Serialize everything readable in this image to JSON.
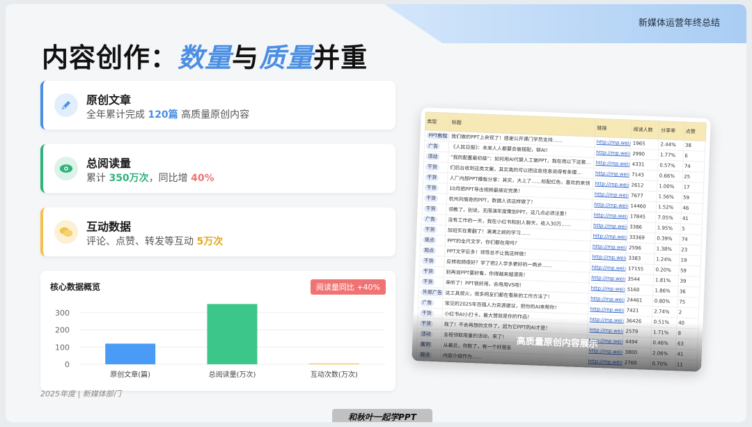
{
  "header": {
    "corner_label": "新媒体运营年终总结"
  },
  "title": {
    "part1": "内容创作：",
    "hl1": "数量",
    "part2": "与",
    "hl2": "质量",
    "part3": "并重"
  },
  "cards": [
    {
      "title": "原创文章",
      "pre": "全年累计完成 ",
      "value": "120篇",
      "post": " 高质量原创内容",
      "color": "#4a8fe3",
      "icon": "pen-icon"
    },
    {
      "title": "总阅读量",
      "pre": "累计 ",
      "value": "350万次",
      "mid": "，同比增 ",
      "value2": "40%",
      "color": "#2fb37a",
      "icon": "eye-icon"
    },
    {
      "title": "互动数据",
      "pre": "评论、点赞、转发等互动 ",
      "value": "5万次",
      "color": "#f2c14e",
      "icon": "chat-icon"
    }
  ],
  "chart_card": {
    "title": "核心数据概览",
    "badge": "阅读量同比 +40%"
  },
  "chart_data": {
    "type": "bar",
    "categories": [
      "原创文章(篇)",
      "总阅读量(万次)",
      "互动次数(万次)"
    ],
    "values": [
      120,
      350,
      5
    ],
    "colors": [
      "#4a9bf5",
      "#3cc68a",
      "#f5c842"
    ],
    "yticks": [
      0,
      100,
      200,
      300
    ],
    "ylim": [
      0,
      380
    ],
    "grid": true
  },
  "footer_note": "2025年度 | 新媒体部门",
  "sheet": {
    "headers": [
      "类型",
      "标题",
      "链接",
      "阅读人数",
      "分享率",
      "点赞"
    ],
    "rows": [
      [
        "PPT教程",
        "我们做的PPT上央视了！感谢公开课门学员支持……",
        "",
        "1965",
        "2.44%",
        "38"
      ],
      [
        "广告",
        "《人民日报》：未来人人都要会做搭配，够AI!",
        "http://mp.weixi",
        "2990",
        "1.77%",
        "6"
      ],
      [
        "活动",
        "“我的配置最初级”：如何用AI代替人工做PPT，我在用以下这套…",
        "",
        "4331",
        "0.57%",
        "74"
      ],
      [
        "干货",
        "们后台收到这类文案，其实真的可以把这些信息说得有条理…",
        "",
        "7143",
        "0.66%",
        "25"
      ],
      [
        "干货",
        "人厂内部PPT模板分享：其实，大上了……标配红色，喜欢的来领",
        "",
        "2612",
        "1.00%",
        "17"
      ],
      [
        "干货",
        "10月把PPT导出视频最接近完美！",
        "",
        "7677",
        "1.56%",
        "59"
      ],
      [
        "干货",
        "杭州风情奇的PPT，数据人该这样做了！",
        "",
        "14460",
        "1.52%",
        "46"
      ],
      [
        "干货",
        "领教了，别说，无限演年度策划PPT，这几点必须注意！",
        "",
        "17845",
        "7.05%",
        "41"
      ],
      [
        "广告",
        "没有工作的一天，我在小红书和别人聊天，收入30万……",
        "",
        "3386",
        "1.95%",
        "5"
      ],
      [
        "干货",
        "加班实在累翻了！满满之前的学习……",
        "",
        "33369",
        "0.39%",
        "74"
      ],
      [
        "观点",
        "PPT的全尺文字，你们都在用吗？",
        "",
        "2596",
        "1.38%",
        "23"
      ],
      [
        "观点",
        "PPT文字巨多！领导总不让我这样做！",
        "",
        "3383",
        "1.24%",
        "19"
      ],
      [
        "干货",
        "反转视频很好？学了把2人学多更好的一两步……",
        "",
        "17155",
        "0.20%",
        "59"
      ],
      [
        "干货",
        "别再说PPT要好看，你得越来越漂亮！",
        "",
        "3544",
        "1.81%",
        "39"
      ],
      [
        "干货",
        "来听了！PPT很好用，会用用VS吧！",
        "",
        "5160",
        "1.86%",
        "36"
      ],
      [
        "外部广告",
        "这工具很火，很多网友们都在看新的工作方法了！",
        "",
        "24461",
        "0.80%",
        "75"
      ],
      [
        "广告",
        "常见的2025年百强人力资源建议，把你的AI来帮你！",
        "",
        "7421",
        "2.74%",
        "2"
      ],
      [
        "干货",
        "小红书AI小打卡，最大赞就是你的作品！",
        "",
        "36426",
        "0.51%",
        "40"
      ],
      [
        "干货",
        "我了！不会再想的文件了，因为它PPT的AI才是！",
        "",
        "2579",
        "1.71%",
        "8"
      ],
      [
        "活动",
        "全程领取限量的活动，来了！",
        "",
        "4494",
        "0.46%",
        "63"
      ],
      [
        "案例",
        "从最近，你数了，有一个好朋友",
        "",
        "3800",
        "2.06%",
        "41"
      ],
      [
        "观点",
        "内容介绍作为……",
        "",
        "2760",
        "0.70%",
        "11"
      ]
    ],
    "link_text": "http://mp.weixi",
    "caption": "高质量原创内容展示"
  },
  "watermark": "和秋叶一起学PPT"
}
